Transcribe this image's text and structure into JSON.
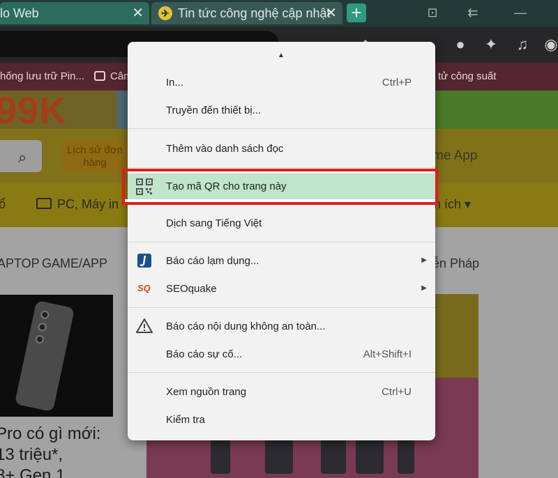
{
  "tabs": [
    {
      "title": "lo Web",
      "close": "✕"
    },
    {
      "title": "Tin tức công nghệ cập nhật",
      "close": "✕"
    }
  ],
  "new_tab": "+",
  "bookmarks": {
    "item1": "hống lưu trữ Pin...",
    "item2": "Câm",
    "item3": "tử công suất"
  },
  "page": {
    "banner_price": "99K",
    "history_button": "Lịch sử đơn hàng",
    "home_app": "me App",
    "nav_pc": "PC, Máy in",
    "nav_left": "ổ",
    "nav_right": "n ích ▾",
    "cat_laptop": "APTOP",
    "cat_game": "GAME/APP",
    "cat_right": "ễn Pháp",
    "article_title_lines": [
      "Pro có gì mới:",
      "13 triệu*,",
      "8+ Gen 1"
    ]
  },
  "menu": {
    "items": [
      {
        "label": "In...",
        "shortcut": "Ctrl+P"
      },
      {
        "label": "Truyền đến thiết bị..."
      },
      {
        "label": "Thêm vào danh sách đọc"
      },
      {
        "label": "Tạo mã QR cho trang này",
        "icon": "qr-code-icon",
        "highlighted": true
      },
      {
        "label": "Dịch sang Tiếng Việt"
      },
      {
        "label": "Báo cáo lạm dụng...",
        "icon": "report-abuse-icon",
        "submenu": "▶"
      },
      {
        "label": "SEOquake",
        "icon": "seoquake-icon",
        "icon_text": "SQ",
        "submenu": "▶"
      },
      {
        "label": "Báo cáo nội dung không an toàn...",
        "icon": "warning-icon"
      },
      {
        "label": "Báo cáo sự cố...",
        "shortcut": "Alt+Shift+I"
      },
      {
        "label": "Xem nguồn trang",
        "shortcut": "Ctrl+U"
      },
      {
        "label": "Kiểm tra"
      }
    ]
  },
  "colors": {
    "highlight_fill": "#bfe5cc",
    "highlight_border": "#e11d1d",
    "tab_active": "#2d6b5d"
  }
}
